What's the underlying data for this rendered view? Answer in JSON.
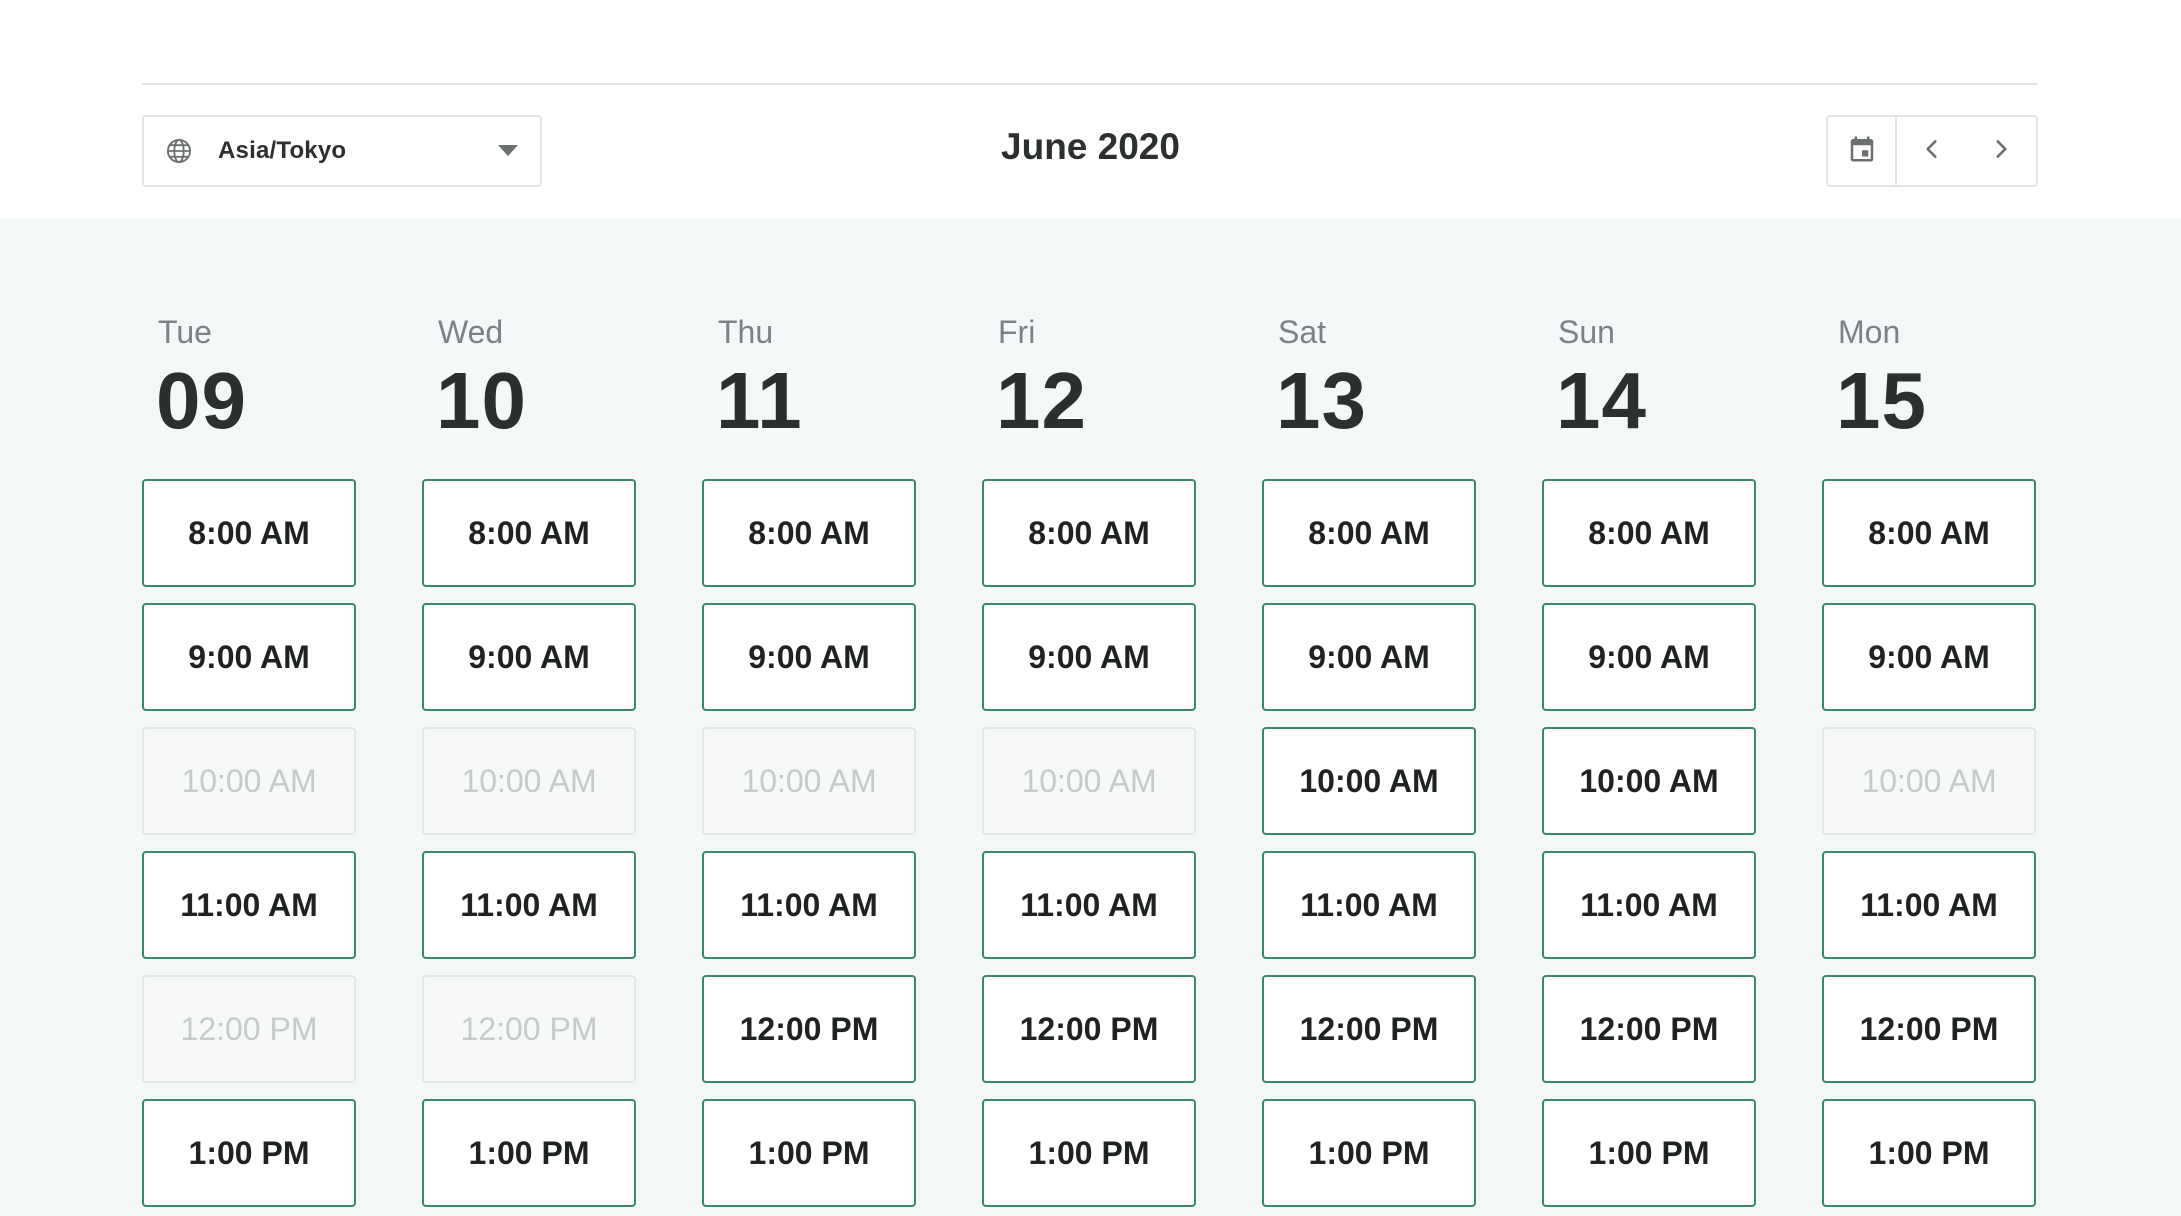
{
  "header": {
    "timezone": "Asia/Tokyo",
    "month_title": "June 2020"
  },
  "icons": {
    "timezone": "globe-icon",
    "calendar": "calendar-icon",
    "prev": "chevron-left-icon",
    "next": "chevron-right-icon",
    "dropdown": "caret-down-icon"
  },
  "colors": {
    "available_border": "#3c8a6e",
    "body_background": "#f5f8f8"
  },
  "days": [
    {
      "name": "Tue",
      "date": "09",
      "slots": [
        {
          "label": "8:00 AM",
          "available": true
        },
        {
          "label": "9:00 AM",
          "available": true
        },
        {
          "label": "10:00 AM",
          "available": false
        },
        {
          "label": "11:00 AM",
          "available": true
        },
        {
          "label": "12:00 PM",
          "available": false
        },
        {
          "label": "1:00 PM",
          "available": true
        }
      ]
    },
    {
      "name": "Wed",
      "date": "10",
      "slots": [
        {
          "label": "8:00 AM",
          "available": true
        },
        {
          "label": "9:00 AM",
          "available": true
        },
        {
          "label": "10:00 AM",
          "available": false
        },
        {
          "label": "11:00 AM",
          "available": true
        },
        {
          "label": "12:00 PM",
          "available": false
        },
        {
          "label": "1:00 PM",
          "available": true
        }
      ]
    },
    {
      "name": "Thu",
      "date": "11",
      "slots": [
        {
          "label": "8:00 AM",
          "available": true
        },
        {
          "label": "9:00 AM",
          "available": true
        },
        {
          "label": "10:00 AM",
          "available": false
        },
        {
          "label": "11:00 AM",
          "available": true
        },
        {
          "label": "12:00 PM",
          "available": true
        },
        {
          "label": "1:00 PM",
          "available": true
        }
      ]
    },
    {
      "name": "Fri",
      "date": "12",
      "slots": [
        {
          "label": "8:00 AM",
          "available": true
        },
        {
          "label": "9:00 AM",
          "available": true
        },
        {
          "label": "10:00 AM",
          "available": false
        },
        {
          "label": "11:00 AM",
          "available": true
        },
        {
          "label": "12:00 PM",
          "available": true
        },
        {
          "label": "1:00 PM",
          "available": true
        }
      ]
    },
    {
      "name": "Sat",
      "date": "13",
      "slots": [
        {
          "label": "8:00 AM",
          "available": true
        },
        {
          "label": "9:00 AM",
          "available": true
        },
        {
          "label": "10:00 AM",
          "available": true
        },
        {
          "label": "11:00 AM",
          "available": true
        },
        {
          "label": "12:00 PM",
          "available": true
        },
        {
          "label": "1:00 PM",
          "available": true
        }
      ]
    },
    {
      "name": "Sun",
      "date": "14",
      "slots": [
        {
          "label": "8:00 AM",
          "available": true
        },
        {
          "label": "9:00 AM",
          "available": true
        },
        {
          "label": "10:00 AM",
          "available": true
        },
        {
          "label": "11:00 AM",
          "available": true
        },
        {
          "label": "12:00 PM",
          "available": true
        },
        {
          "label": "1:00 PM",
          "available": true
        }
      ]
    },
    {
      "name": "Mon",
      "date": "15",
      "slots": [
        {
          "label": "8:00 AM",
          "available": true
        },
        {
          "label": "9:00 AM",
          "available": true
        },
        {
          "label": "10:00 AM",
          "available": false
        },
        {
          "label": "11:00 AM",
          "available": true
        },
        {
          "label": "12:00 PM",
          "available": true
        },
        {
          "label": "1:00 PM",
          "available": true
        }
      ]
    }
  ]
}
